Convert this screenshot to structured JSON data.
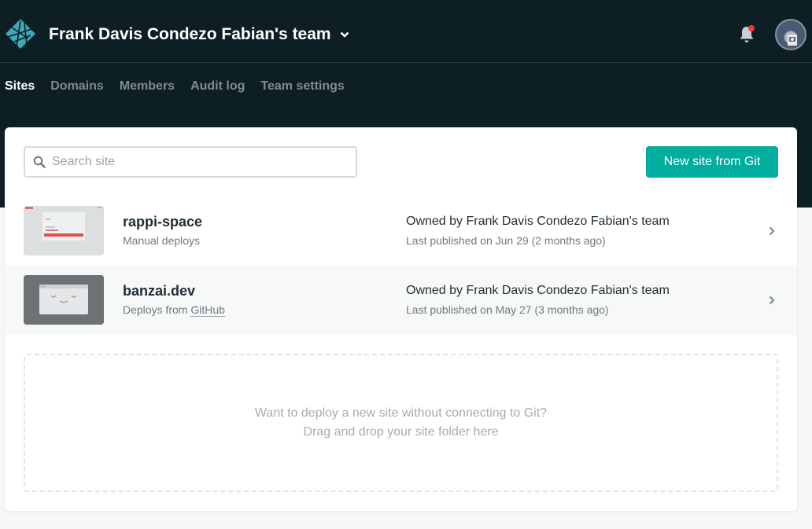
{
  "header": {
    "team_name": "Frank Davis Condezo Fabian's team"
  },
  "nav": {
    "items": [
      {
        "label": "Sites",
        "active": true
      },
      {
        "label": "Domains",
        "active": false
      },
      {
        "label": "Members",
        "active": false
      },
      {
        "label": "Audit log",
        "active": false
      },
      {
        "label": "Team settings",
        "active": false
      }
    ]
  },
  "search": {
    "placeholder": "Search site",
    "value": ""
  },
  "toolbar": {
    "new_site_label": "New site from Git"
  },
  "sites": [
    {
      "name": "rappi-space",
      "deploy_text": "Manual deploys",
      "owner": "Owned by Frank Davis Condezo Fabian's team",
      "published": "Last published on Jun 29 (2 months ago)"
    },
    {
      "name": "banzai.dev",
      "deploy_prefix": "Deploys from ",
      "deploy_link": "GitHub",
      "owner": "Owned by Frank Davis Condezo Fabian's team",
      "published": "Last published on May 27 (3 months ago)"
    }
  ],
  "dropzone": {
    "line1": "Want to deploy a new site without connecting to Git?",
    "line2": "Drag and drop your site folder here"
  },
  "colors": {
    "topbar": "#0e1e25",
    "accent": "#00ad9f",
    "notification_dot": "#f0393f",
    "logo": "#3fa7b7"
  },
  "icons": {
    "logo": "netlify-logo-icon",
    "team_switch": "chevron-down-icon",
    "notifications": "bell-icon",
    "search": "search-icon",
    "row_open": "chevron-right-icon"
  }
}
